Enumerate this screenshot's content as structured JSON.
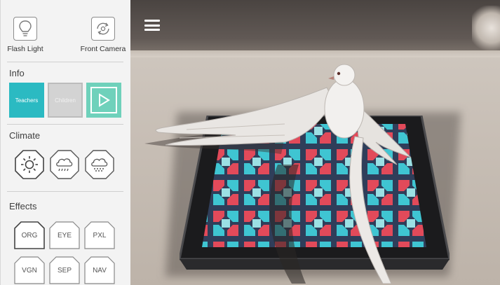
{
  "top_tools": {
    "flash_label": "Flash Light",
    "camera_label": "Front Camera"
  },
  "info": {
    "title": "Info",
    "teachers_label": "Teachers",
    "children_label": "Children"
  },
  "climate": {
    "title": "Climate",
    "items": [
      {
        "icon": "sun-icon"
      },
      {
        "icon": "rain-cloud-icon"
      },
      {
        "icon": "snow-cloud-icon"
      }
    ]
  },
  "effects": {
    "title": "Effects",
    "items": [
      "ORG",
      "EYE",
      "PXL",
      "VGN",
      "SEP",
      "NAV"
    ]
  },
  "colors": {
    "teachers_bg": "#2bbac2",
    "ar_bg": "#6fd1bb",
    "sidebar_bg": "#f3f3f3"
  }
}
